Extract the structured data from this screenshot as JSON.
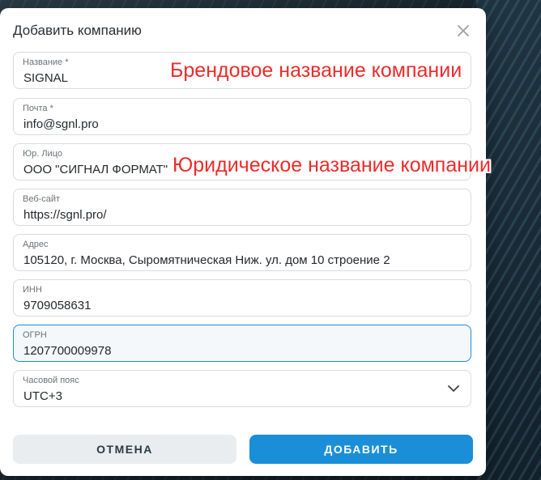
{
  "modal": {
    "title": "Добавить компанию",
    "close_icon": "close-icon"
  },
  "fields": {
    "name": {
      "label": "Название *",
      "value": "SIGNAL"
    },
    "email": {
      "label": "Почта *",
      "value": "info@sgnl.pro"
    },
    "legal": {
      "label": "Юр. Лицо",
      "value": "ООО \"СИГНАЛ ФОРМАТ\""
    },
    "website": {
      "label": "Веб-сайт",
      "value": "https://sgnl.pro/"
    },
    "address": {
      "label": "Адрес",
      "value": "105120, г. Москва, Сыромятническая Ниж. ул. дом 10 строение 2"
    },
    "inn": {
      "label": "ИНН",
      "value": "9709058631"
    },
    "ogrn": {
      "label": "ОГРН",
      "value": "1207700009978"
    },
    "timezone": {
      "label": "Часовой пояс",
      "value": "UTC+3",
      "icon": "chevron-down-icon"
    }
  },
  "annotations": {
    "brand": "Брендовое название компании",
    "legal": "Юридическое название компании"
  },
  "buttons": {
    "cancel": "ОТМЕНА",
    "add": "ДОБАВИТЬ"
  },
  "colors": {
    "accent": "#1a8fd8",
    "annotation": "#ee2b2b",
    "focus_border": "#1e8ed4"
  }
}
